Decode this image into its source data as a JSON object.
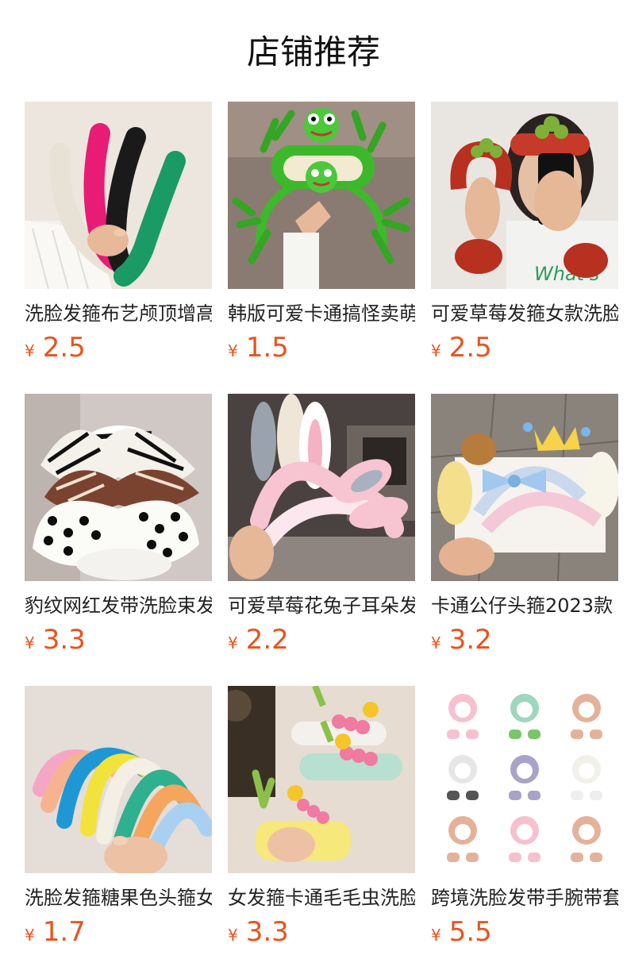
{
  "page": {
    "title": "店铺推荐"
  },
  "colors": {
    "price": "#e8541c",
    "title": "#111111",
    "text": "#222222"
  },
  "products": [
    {
      "name": "洗脸发箍布艺颅顶增高",
      "currency": "¥",
      "price": "2.5",
      "image": "braided-headbands-photo"
    },
    {
      "name": "韩版可爱卡通搞怪卖萌",
      "currency": "¥",
      "price": "1.5",
      "image": "frog-headband-photo"
    },
    {
      "name": "可爱草莓发箍女款洗脸",
      "currency": "¥",
      "price": "2.5",
      "image": "strawberry-headband-photo"
    },
    {
      "name": "豹纹网红发带洗脸束发",
      "currency": "¥",
      "price": "3.3",
      "image": "zebra-bow-headband-photo"
    },
    {
      "name": "可爱草莓花兔子耳朵发",
      "currency": "¥",
      "price": "2.2",
      "image": "bunny-ear-headband-photo"
    },
    {
      "name": "卡通公仔头箍2023款",
      "currency": "¥",
      "price": "3.2",
      "image": "cartoon-character-headband-photo"
    },
    {
      "name": "洗脸发箍糖果色头箍女",
      "currency": "¥",
      "price": "1.7",
      "image": "candy-color-headbands-photo"
    },
    {
      "name": "女发箍卡通毛毛虫洗脸",
      "currency": "¥",
      "price": "3.3",
      "image": "caterpillar-headband-photo"
    },
    {
      "name": "跨境洗脸发带手腕带套",
      "currency": "¥",
      "price": "5.5",
      "image": "headband-wristband-set-photo"
    }
  ]
}
